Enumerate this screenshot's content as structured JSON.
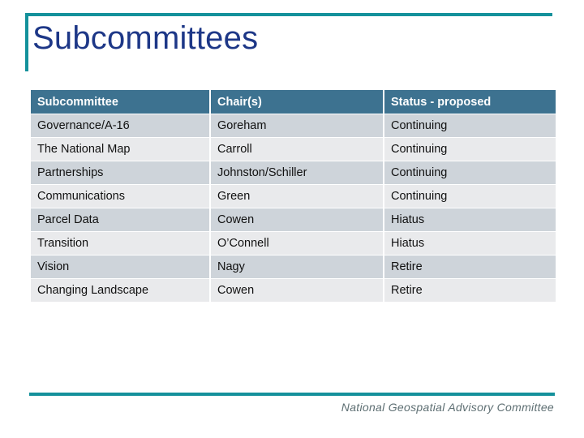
{
  "slide": {
    "title": "Subcommittees",
    "footer": "National Geospatial Advisory Committee",
    "accent_color": "#14919b",
    "title_color": "#1d3787",
    "header_bg_color": "#3d7290",
    "row_odd_color": "#ced4da",
    "row_even_color": "#e9eaec"
  },
  "table": {
    "columns": [
      "Subcommittee",
      "Chair(s)",
      "Status - proposed"
    ],
    "rows": [
      {
        "subcommittee": "Governance/A-16",
        "chair": "Goreham",
        "status": "Continuing"
      },
      {
        "subcommittee": "The National Map",
        "chair": "Carroll",
        "status": "Continuing"
      },
      {
        "subcommittee": "Partnerships",
        "chair": "Johnston/Schiller",
        "status": "Continuing"
      },
      {
        "subcommittee": "Communications",
        "chair": "Green",
        "status": "Continuing"
      },
      {
        "subcommittee": "Parcel Data",
        "chair": "Cowen",
        "status": "Hiatus"
      },
      {
        "subcommittee": "Transition",
        "chair": "O’Connell",
        "status": "Hiatus"
      },
      {
        "subcommittee": "Vision",
        "chair": "Nagy",
        "status": "Retire"
      },
      {
        "subcommittee": "Changing Landscape",
        "chair": "Cowen",
        "status": "Retire"
      }
    ]
  }
}
